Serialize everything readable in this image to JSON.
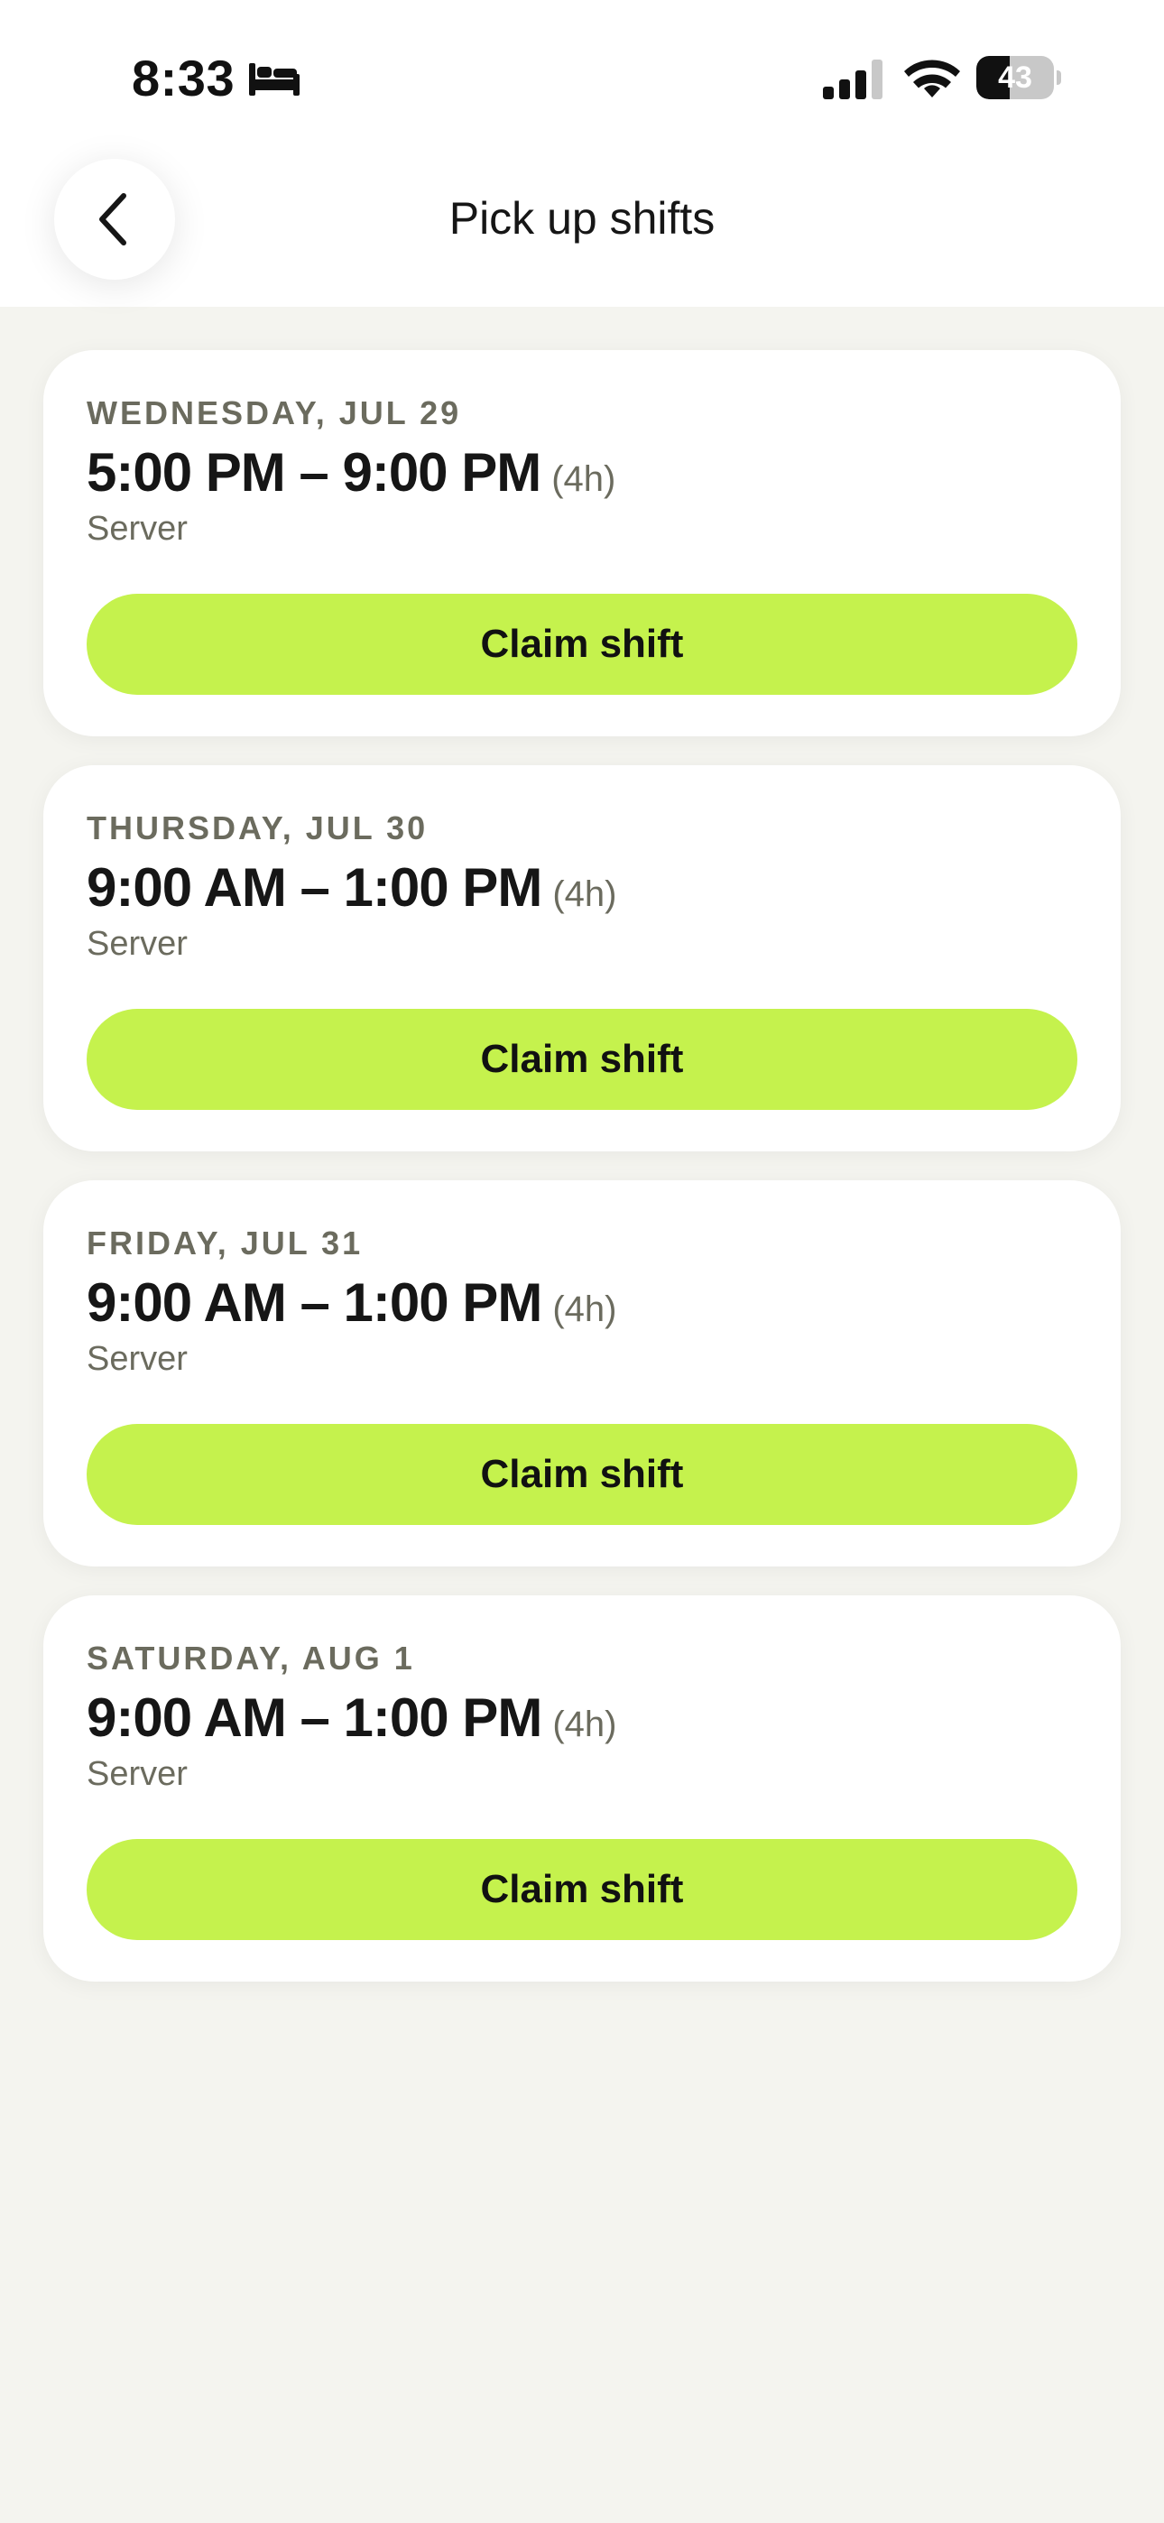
{
  "status_bar": {
    "time": "8:33",
    "focus_icon": "bed-icon",
    "signal_icon": "cellular-signal-icon",
    "wifi_icon": "wifi-icon",
    "battery_level": "43",
    "battery_fill_fraction": 0.43
  },
  "nav": {
    "back_icon": "chevron-left-icon",
    "title": "Pick up shifts"
  },
  "colors": {
    "accent": "#c5f24d",
    "background": "#f4f4ef",
    "card": "#ffffff",
    "muted_text": "#6b6b5e"
  },
  "shifts": [
    {
      "date": "WEDNESDAY, JUL 29",
      "time": "5:00 PM – 9:00 PM",
      "duration": "(4h)",
      "role": "Server",
      "button_label": "Claim shift"
    },
    {
      "date": "THURSDAY, JUL 30",
      "time": "9:00 AM – 1:00 PM",
      "duration": "(4h)",
      "role": "Server",
      "button_label": "Claim shift"
    },
    {
      "date": "FRIDAY, JUL 31",
      "time": "9:00 AM – 1:00 PM",
      "duration": "(4h)",
      "role": "Server",
      "button_label": "Claim shift"
    },
    {
      "date": "SATURDAY, AUG 1",
      "time": "9:00 AM – 1:00 PM",
      "duration": "(4h)",
      "role": "Server",
      "button_label": "Claim shift"
    }
  ]
}
